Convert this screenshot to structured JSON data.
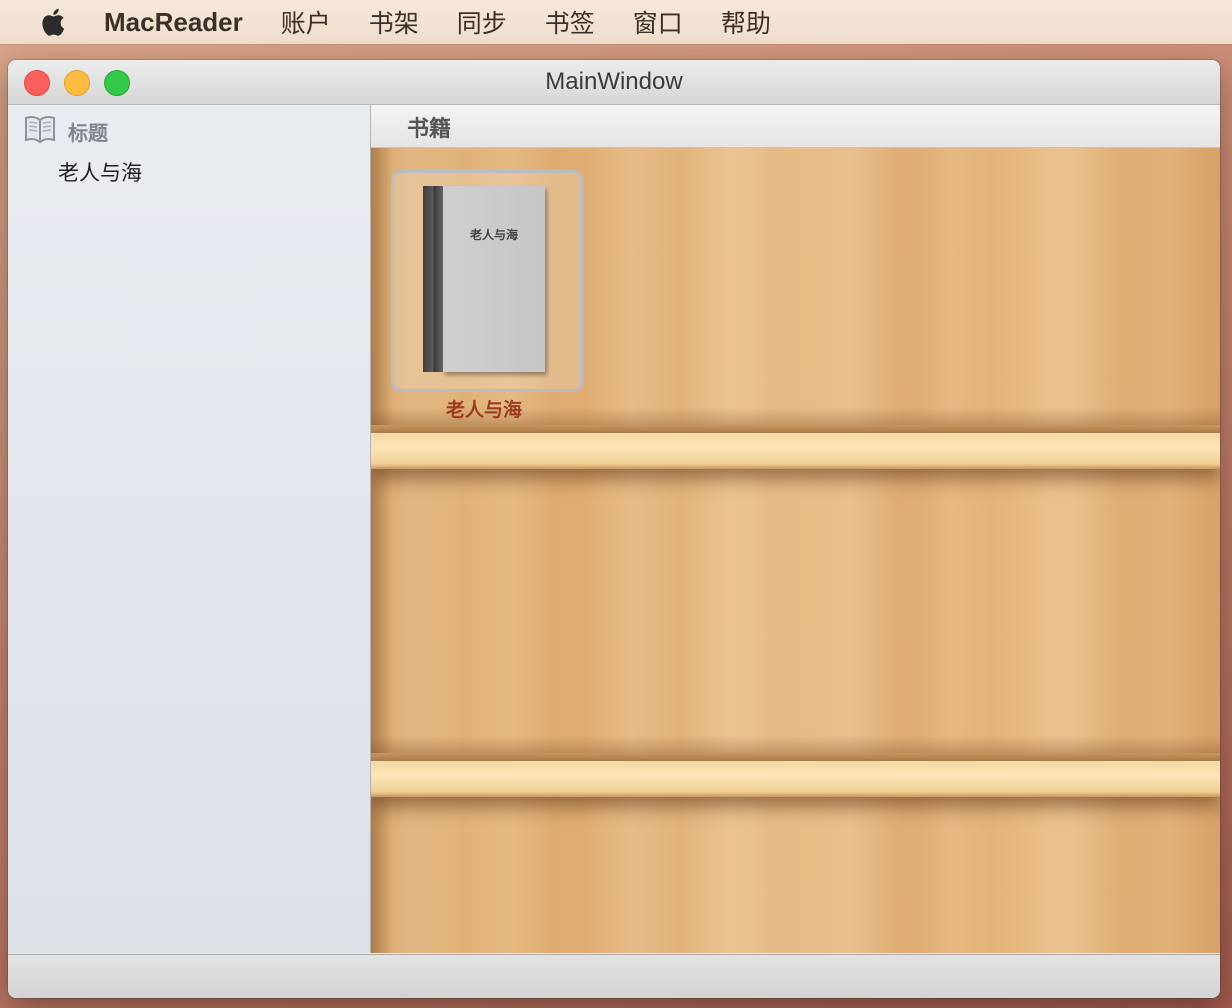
{
  "menubar": {
    "apple_icon": "apple-logo-icon",
    "app_name": "MacReader",
    "items": [
      "账户",
      "书架",
      "同步",
      "书签",
      "窗口",
      "帮助"
    ]
  },
  "window": {
    "title": "MainWindow"
  },
  "sidebar": {
    "header_icon": "book-open-icon",
    "header_label": "标题",
    "items": [
      {
        "label": "老人与海"
      }
    ]
  },
  "bookshelf": {
    "column_header": "书籍",
    "books": [
      {
        "cover_title": "老人与海",
        "label": "老人与海"
      }
    ]
  },
  "colors": {
    "book_label": "#9c3b22",
    "close": "#fc605c",
    "minimize": "#fdbc40",
    "maximize": "#34c84a"
  }
}
